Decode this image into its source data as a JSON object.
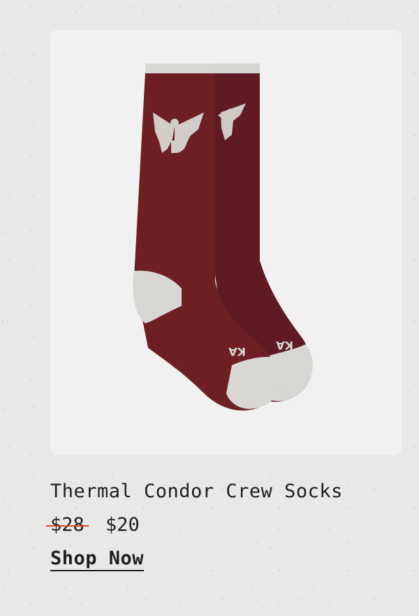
{
  "product": {
    "title": "Thermal Condor Crew Socks",
    "original_price": "$28",
    "sale_price": "$20",
    "cta_label": "Shop Now",
    "image_alt": "Burgundy crew socks with grey condor pattern",
    "sock_brand_mark": "KA"
  },
  "colors": {
    "background": "#e9e8e6",
    "image_panel": "#f1f1f1",
    "sock_main": "#6e1f24",
    "sock_accent": "#d8d7d4",
    "strikethrough": "#d14b2a",
    "text": "#1f1f1f"
  }
}
